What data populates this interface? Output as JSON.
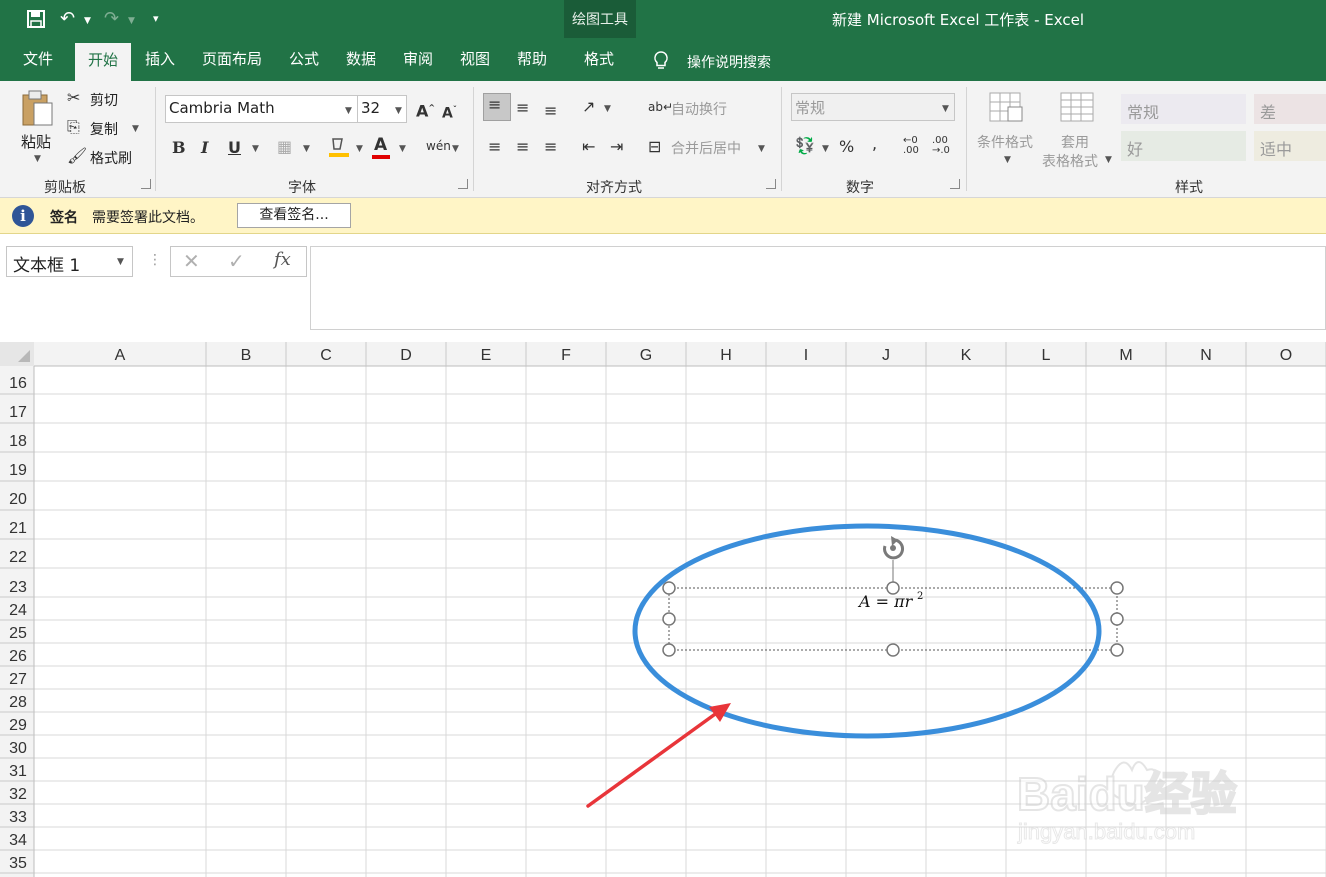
{
  "window": {
    "context_tool_title": "绘图工具",
    "document_title": "新建 Microsoft Excel 工作表  -  Excel"
  },
  "tabs": [
    {
      "label": "文件",
      "active": false
    },
    {
      "label": "开始",
      "active": true
    },
    {
      "label": "插入",
      "active": false
    },
    {
      "label": "页面布局",
      "active": false
    },
    {
      "label": "公式",
      "active": false
    },
    {
      "label": "数据",
      "active": false
    },
    {
      "label": "审阅",
      "active": false
    },
    {
      "label": "视图",
      "active": false
    },
    {
      "label": "帮助",
      "active": false
    },
    {
      "label": "格式",
      "active": false
    }
  ],
  "tell_me": "操作说明搜索",
  "ribbon": {
    "clipboard": {
      "paste": "粘贴",
      "cut": "剪切",
      "copy": "复制",
      "format_painter": "格式刷",
      "group": "剪贴板"
    },
    "font": {
      "name": "Cambria Math",
      "size": "32",
      "group": "字体"
    },
    "alignment": {
      "wrap": "自动换行",
      "merge": "合并后居中",
      "group": "对齐方式"
    },
    "number": {
      "format": "常规",
      "group": "数字"
    },
    "styles": {
      "conditional": [
        "条件格式"
      ],
      "table": [
        "套用",
        "表格格式"
      ],
      "cells": [
        "常规",
        "差",
        "好",
        "适中"
      ],
      "group": "样式"
    }
  },
  "message_bar": {
    "title": "签名",
    "text": "需要签署此文档。",
    "button": "查看签名..."
  },
  "formula_bar": {
    "name_box": "文本框 1",
    "fx": "fx"
  },
  "sheet": {
    "columns": [
      "A",
      "B",
      "C",
      "D",
      "E",
      "F",
      "G",
      "H",
      "I",
      "J",
      "K",
      "L",
      "M",
      "N",
      "O"
    ],
    "rows": [
      "16",
      "17",
      "18",
      "19",
      "20",
      "21",
      "22",
      "23",
      "24",
      "25",
      "26",
      "27",
      "28",
      "29",
      "30",
      "31",
      "32",
      "33",
      "34",
      "35"
    ]
  },
  "textbox": {
    "formula_main": "A = πr",
    "formula_exp": "2"
  },
  "annotation": {
    "ellipse_color": "#3a8edb",
    "arrow_color": "#e8353a"
  },
  "watermark": {
    "main": "Baidu经验",
    "sub": "jingyan.baidu.com"
  },
  "colors": {
    "brand_green": "#217346",
    "info_blue": "#2f5597",
    "highlight_red": "#e00000"
  }
}
